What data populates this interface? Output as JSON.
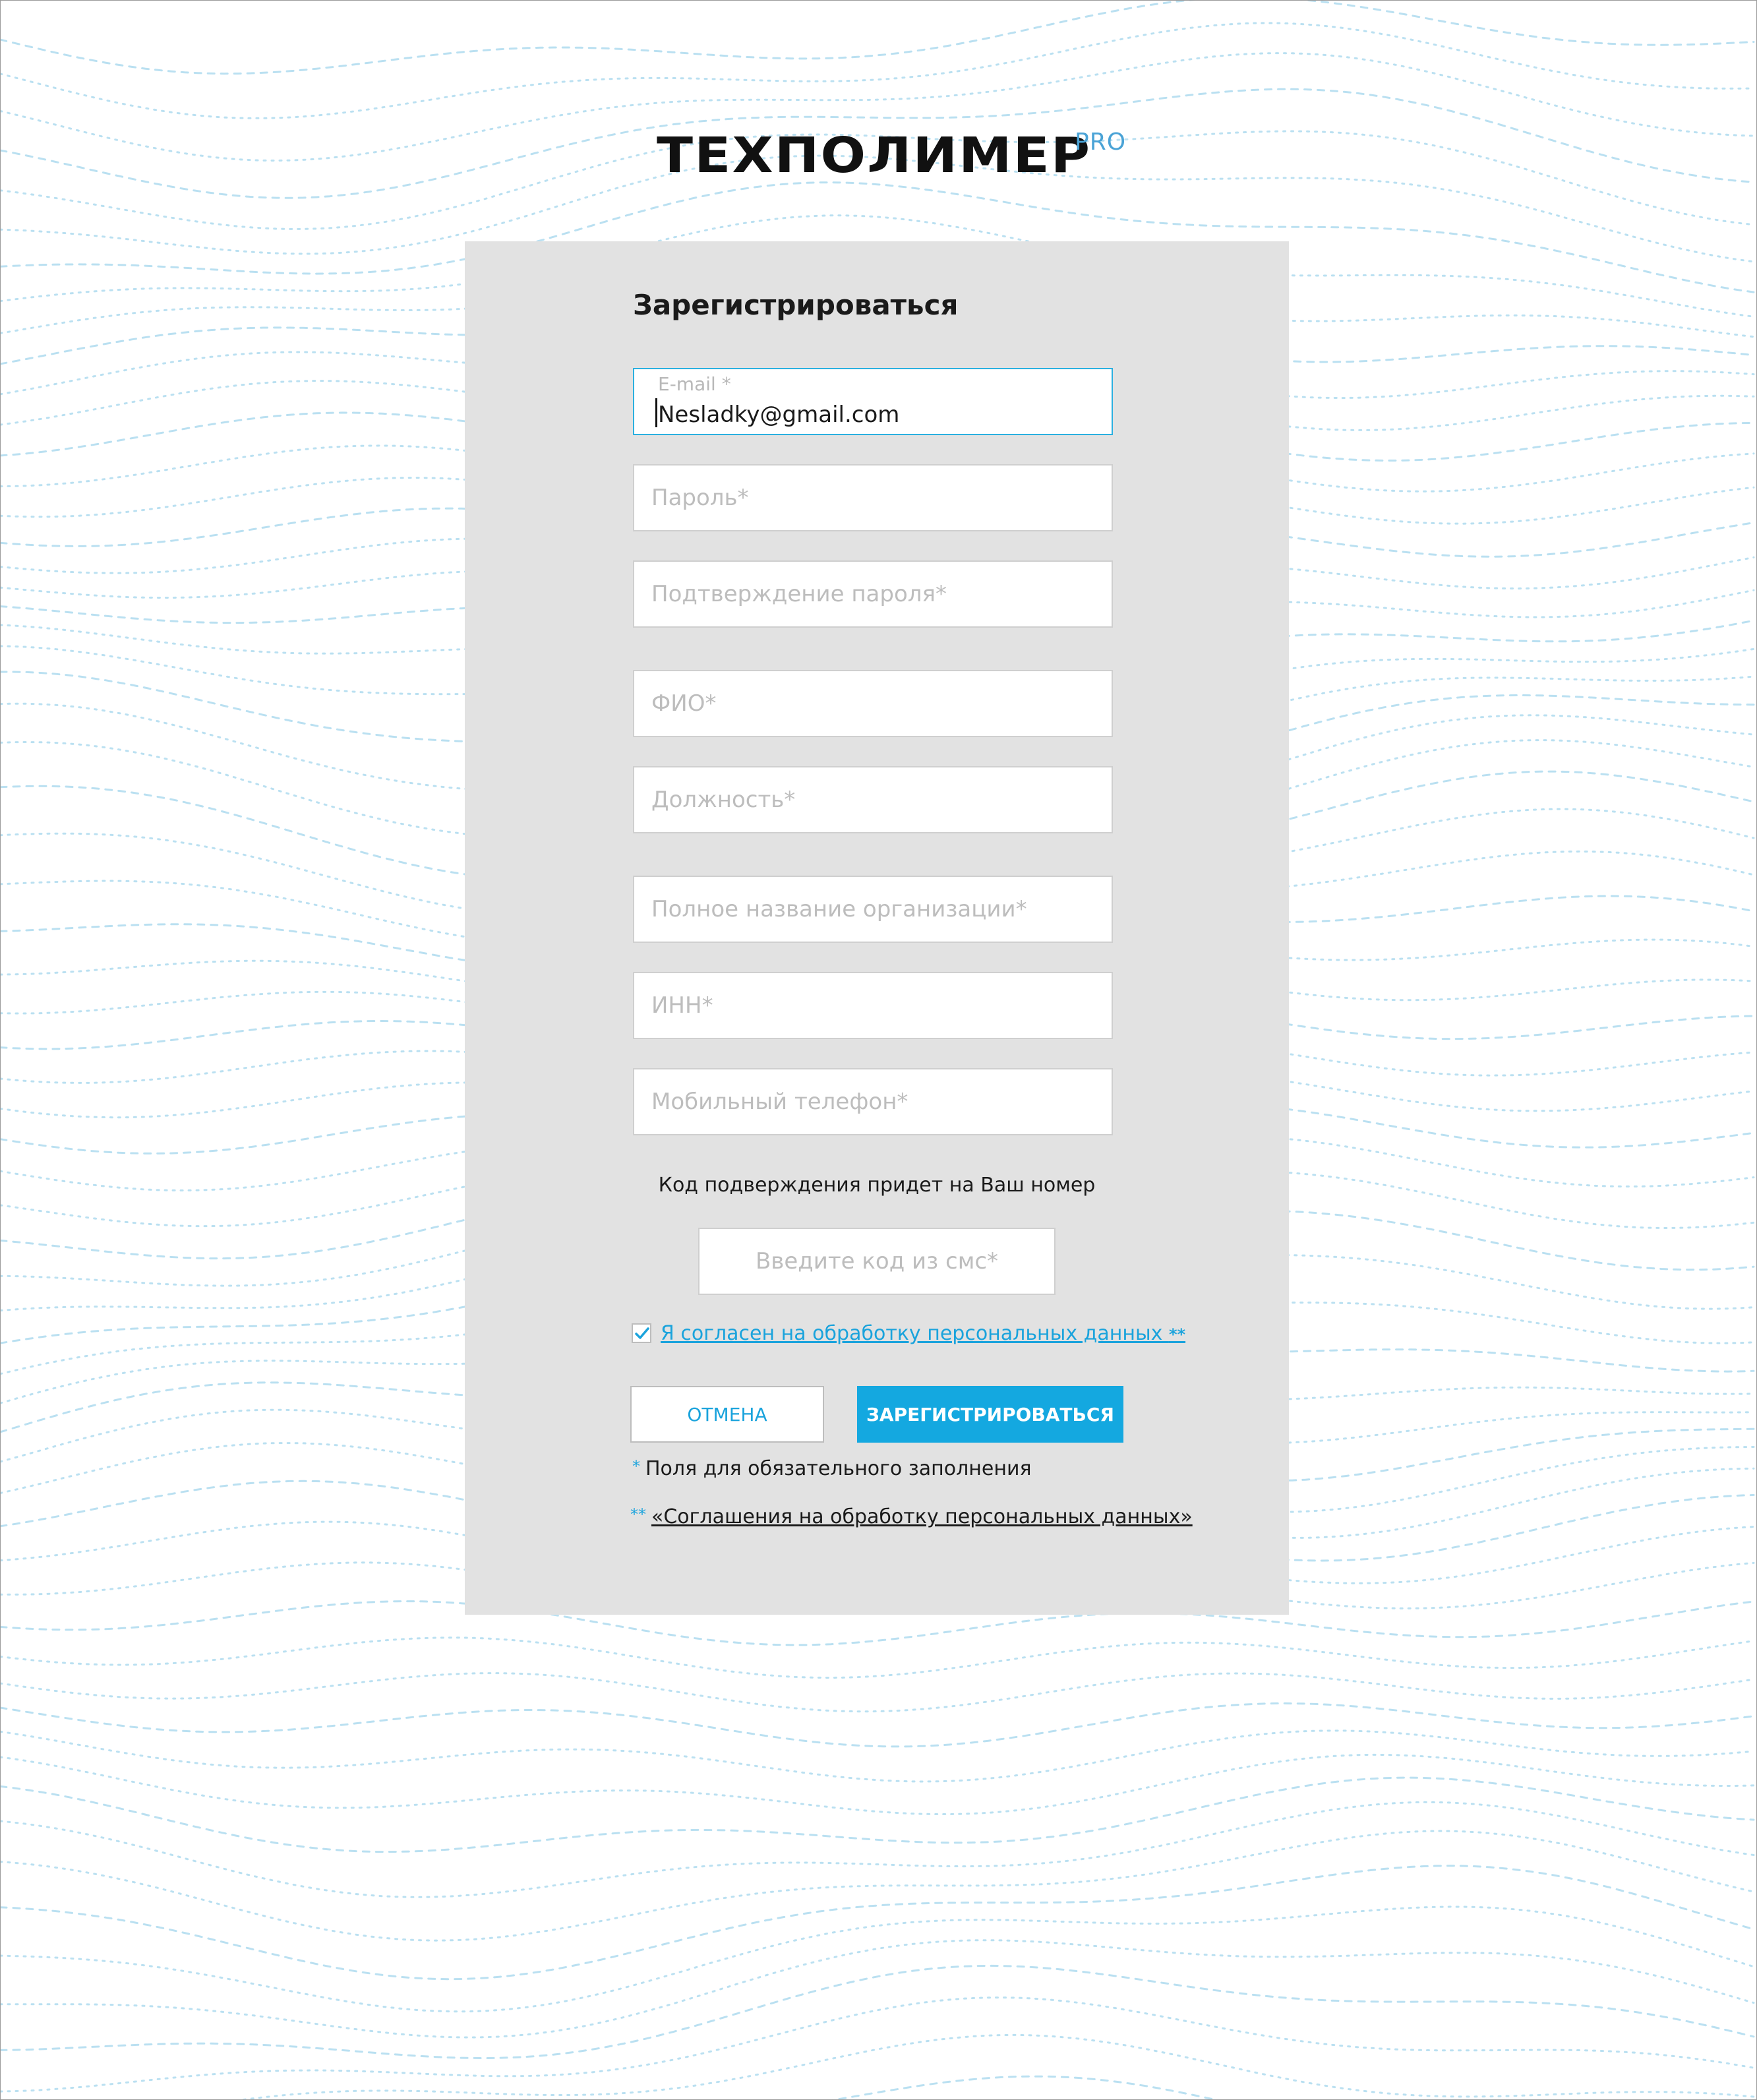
{
  "brand": {
    "logo_text": "ТЕХПОЛИМЕР",
    "logo_suffix": "PRO",
    "accent_color": "#14a8e0"
  },
  "form": {
    "title": "Зарегистрироваться",
    "email": {
      "label": "E-mail *",
      "value": "Nesladky@gmail.com"
    },
    "password_placeholder": "Пароль*",
    "password_confirm_placeholder": "Подтверждение пароля*",
    "full_name_placeholder": "ФИО*",
    "position_placeholder": "Должность*",
    "organization_placeholder": "Полное название организации*",
    "inn_placeholder": "ИНН*",
    "phone_placeholder": "Мобильный телефон*",
    "sms_hint": "Код подверждения придет на Ваш номер",
    "sms_code_placeholder": "Введите код из смс*",
    "consent": {
      "checked": true,
      "label": "Я согласен на обработку персональных данных ",
      "marker": "**"
    },
    "cancel_label": "ОТМЕНА",
    "register_label": "ЗАРЕГИСТРИРОВАТЬСЯ",
    "required_note": {
      "marker": "*",
      "text": "Поля для обязательного заполнения"
    },
    "agreement_note": {
      "marker": "**",
      "text": "«Соглашения на обработку персональных данных» "
    }
  }
}
